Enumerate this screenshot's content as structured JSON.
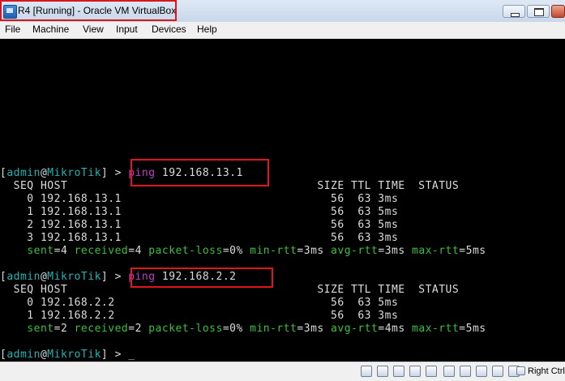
{
  "window": {
    "title": "R4 [Running] - Oracle VM VirtualBox"
  },
  "menu": [
    "File",
    "Machine",
    "View",
    "Input",
    "Devices",
    "Help"
  ],
  "console": {
    "prompt1": {
      "open": "[",
      "user": "admin",
      "at": "@",
      "host": "MikroTik",
      "close": "] > ",
      "cmd": "ping",
      "args": " 192.168.13.1"
    },
    "header1": "  SEQ HOST                                     SIZE TTL TIME  STATUS",
    "rows1": [
      "    0 192.168.13.1                               56  63 3ms",
      "    1 192.168.13.1                               56  63 5ms",
      "    2 192.168.13.1                               56  63 5ms",
      "    3 192.168.13.1                               56  63 3ms"
    ],
    "summary1": {
      "indent": "    ",
      "sent_k": "sent",
      "eq1": "=",
      "sent_v": "4",
      "recv_k": " received",
      "eq2": "=",
      "recv_v": "4",
      "loss_k": " packet-loss",
      "eq3": "=",
      "loss_v": "0%",
      "min_k": " min-rtt",
      "eq4": "=",
      "min_v": "3ms",
      "avg_k": " avg-rtt",
      "eq5": "=",
      "avg_v": "3ms",
      "max_k": " max-rtt",
      "eq6": "=",
      "max_v": "5ms"
    },
    "prompt2": {
      "open": "[",
      "user": "admin",
      "at": "@",
      "host": "MikroTik",
      "close": "] > ",
      "cmd": "ping",
      "args": " 192.168.2.2"
    },
    "header2": "  SEQ HOST                                     SIZE TTL TIME  STATUS",
    "rows2": [
      "    0 192.168.2.2                                56  63 5ms",
      "    1 192.168.2.2                                56  63 3ms"
    ],
    "summary2": {
      "indent": "    ",
      "sent_k": "sent",
      "eq1": "=",
      "sent_v": "2",
      "recv_k": " received",
      "eq2": "=",
      "recv_v": "2",
      "loss_k": " packet-loss",
      "eq3": "=",
      "loss_v": "0%",
      "min_k": " min-rtt",
      "eq4": "=",
      "min_v": "3ms",
      "avg_k": " avg-rtt",
      "eq5": "=",
      "avg_v": "4ms",
      "max_k": " max-rtt",
      "eq6": "=",
      "max_v": "5ms"
    },
    "prompt3": {
      "open": "[",
      "user": "admin",
      "at": "@",
      "host": "MikroTik",
      "close": "] > ",
      "cursor": "_"
    }
  },
  "statusbar": {
    "icons": [
      "hard-disk-icon",
      "optical-drive-icon",
      "usb-icon",
      "network-icon",
      "shared-folder-icon",
      "display-icon",
      "capture-icon",
      "recording-icon",
      "cpu-icon",
      "mouse-integration-icon",
      "keyboard-icon"
    ],
    "host_key": "Right Ctrl"
  },
  "colors": {
    "highlight": "#d9161c",
    "console_bg": "#000000",
    "prompt_cyan": "#1fb3b3",
    "stat_green": "#3cbf3c",
    "cmd_magenta": "#c23cc2"
  }
}
